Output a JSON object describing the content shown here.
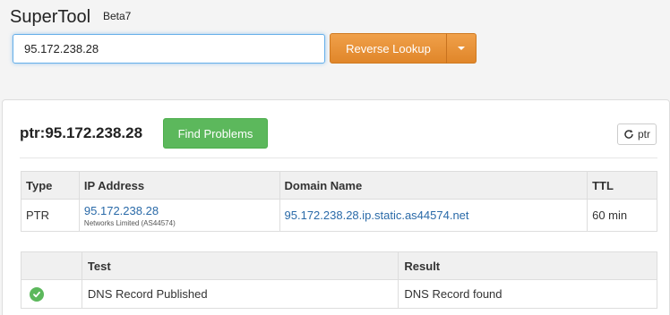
{
  "header": {
    "brand": "SuperTool",
    "brand_sup": "Beta7",
    "search_value": "95.172.238.28",
    "lookup_button": "Reverse Lookup"
  },
  "panel": {
    "title": "ptr:95.172.238.28",
    "find_problems_button": "Find Problems",
    "refresh_button": "ptr"
  },
  "records_table": {
    "headers": [
      "Type",
      "IP Address",
      "Domain Name",
      "TTL"
    ],
    "rows": [
      {
        "type": "PTR",
        "ip": "95.172.238.28",
        "ip_org": "Networks Limited (AS44574)",
        "domain": "95.172.238.28.ip.static.as44574.net",
        "ttl": "60 min"
      }
    ]
  },
  "tests_table": {
    "headers": [
      "",
      "Test",
      "Result"
    ],
    "rows": [
      {
        "status": "check-circle-icon",
        "test": "DNS Record Published",
        "result": "DNS Record found"
      }
    ]
  },
  "colors": {
    "accent": "#e8922f",
    "success": "#5cb85c",
    "link": "#2a6aa8"
  }
}
